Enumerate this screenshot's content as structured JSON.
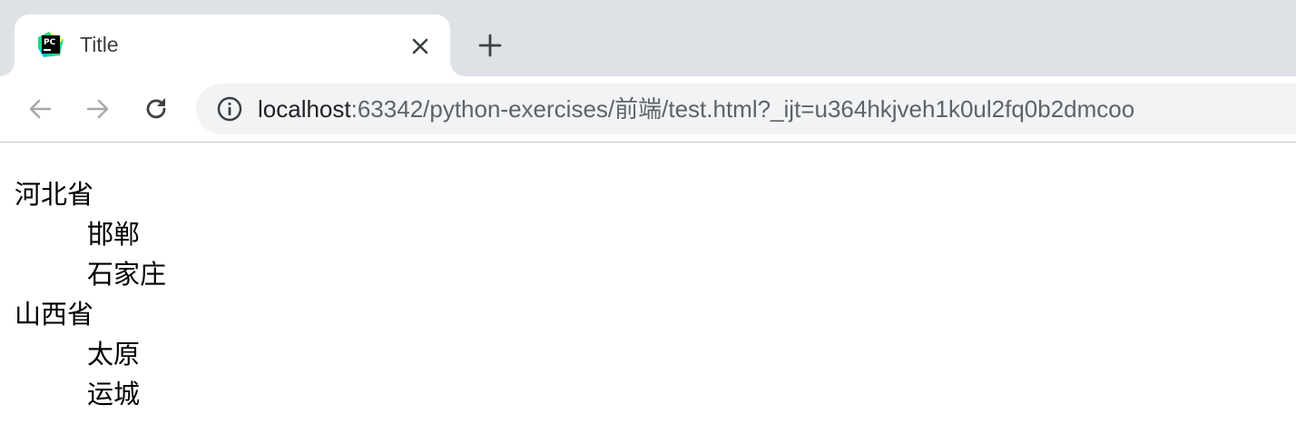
{
  "browser": {
    "tab": {
      "title": "Title",
      "favicon": "pycharm-icon"
    },
    "new_tab_icon": "plus-icon",
    "nav": {
      "back_icon": "arrow-left-icon",
      "forward_icon": "arrow-right-icon",
      "reload_icon": "reload-icon"
    },
    "address_bar": {
      "info_icon": "info-icon",
      "host": "localhost",
      "rest": ":63342/python-exercises/前端/test.html?_ijt=u364hkjveh1k0ul2fq0b2dmcoo"
    }
  },
  "page": {
    "provinces": [
      {
        "name": "河北省",
        "cities": [
          "邯郸",
          "石家庄"
        ]
      },
      {
        "name": "山西省",
        "cities": [
          "太原",
          "运城"
        ]
      }
    ]
  },
  "colors": {
    "tabstrip": "#dee1e6",
    "omnibox": "#f1f3f4",
    "url_muted": "#5f6368"
  }
}
